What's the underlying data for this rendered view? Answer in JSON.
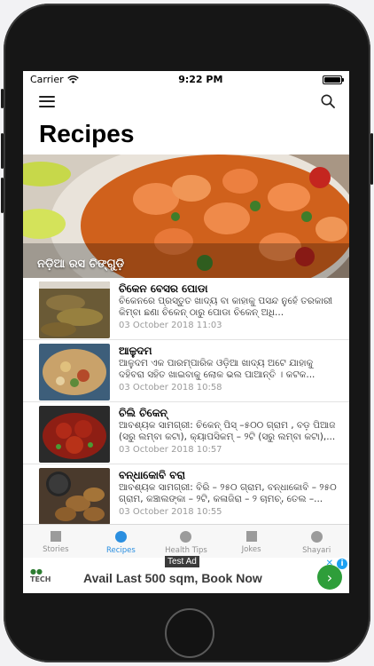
{
  "status": {
    "carrier": "Carrier",
    "time": "9:22 PM"
  },
  "nav": {
    "menu_icon": "hamburger-icon",
    "search_icon": "search-icon"
  },
  "page": {
    "title": "Recipes"
  },
  "hero": {
    "caption": "ନଡ଼ିଆ ରସ ଚିଙ୍ଗୁଡ଼ି"
  },
  "recipes": [
    {
      "title": "ଚିକେନ ବେସର ପୋଡା",
      "body": "ଚିକେନରେ ପ୍ରସ୍ତୁତ ଖାଦ୍ୟ ବା କାହାକୁ ପସନ୍ଦ ନୁହେଁ ତରକାରୀ କିମ୍ବା ଛଣା ଚିକେନ୍ ଠାରୁ ପୋଡା ଚିକେନ୍ ଅଧି...",
      "date": "03 October 2018 11:03"
    },
    {
      "title": "ଆଳୁଦମ",
      "body": "ଆଳୁଦମ ଏକ ପାରମ୍ପାରିକ ଓଡ଼ିଆ ଖାଦ୍ୟ ଅଟେ ଯାହାକୁ ଦହିବରା ସହିତ ଖାଇବାକୁ ଲୋକ ଭଲ ପାଆନ୍ତି । କଟକ...",
      "date": "03 October 2018 10:58"
    },
    {
      "title": "ଚିଲି ଚିକେନ୍",
      "body": "ଆବଶ୍ୟକ ସାମଗ୍ରୀ: ଚିକେନ୍ ପିସ୍ –୫୦୦ ଗ୍ରାମ , ବଡ଼ ପିଆଜ (ସରୁ ଲମ୍ବା କଟା), କ୍ୟାପସିକମ୍ – ୨ଟି (ସରୁ ଲମ୍ବା କଟା),...",
      "date": "03 October 2018 10:57"
    },
    {
      "title": "ବନ୍ଧାକୋବି ବରା",
      "body": "ଆବଶ୍ୟକ ସାମଗ୍ରୀ: ବିରି – ୨୫୦ ଗ୍ରାମ, ବନ୍ଧାକୋବି – ୨୫୦ ଗ୍ରାମ, କଞ୍ଚାଲଙ୍କା – ୨ଟି, କଳାଜିରା – ୨ ଚାମଚ୍, ତେଲ –...",
      "date": "03 October 2018 10:55"
    }
  ],
  "tabs": [
    {
      "label": "Stories",
      "icon": "stories-icon"
    },
    {
      "label": "Recipes",
      "icon": "recipes-icon"
    },
    {
      "label": "Health Tips",
      "icon": "health-tips-icon"
    },
    {
      "label": "Jokes",
      "icon": "jokes-icon"
    },
    {
      "label": "Shayari",
      "icon": "shayari-icon"
    }
  ],
  "active_tab": "Recipes",
  "ad": {
    "badge": "Test Ad",
    "logo_text": "TECH",
    "text": "Avail Last 500 sqm, Book Now",
    "cta_icon": "chevron-right-icon",
    "info_icon": "info-icon",
    "close_icon": "close-icon"
  },
  "colors": {
    "accent": "#2b8fe0",
    "ad_cta": "#2e9e3a"
  }
}
